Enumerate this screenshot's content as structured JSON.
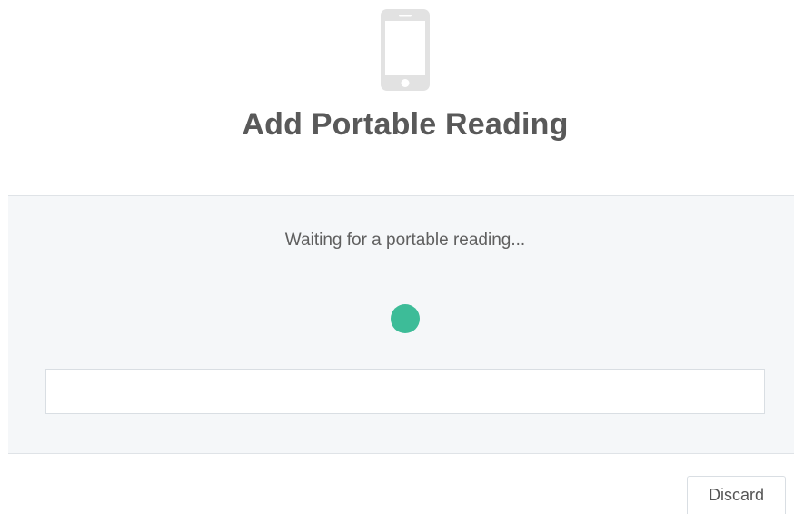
{
  "dialog": {
    "icon": "mobile-phone-icon",
    "title": "Add Portable Reading"
  },
  "status": {
    "message": "Waiting for a portable reading...",
    "indicator_color": "#3dbc98"
  },
  "reading_input": {
    "value": "",
    "placeholder": ""
  },
  "actions": {
    "discard_label": "Discard"
  }
}
